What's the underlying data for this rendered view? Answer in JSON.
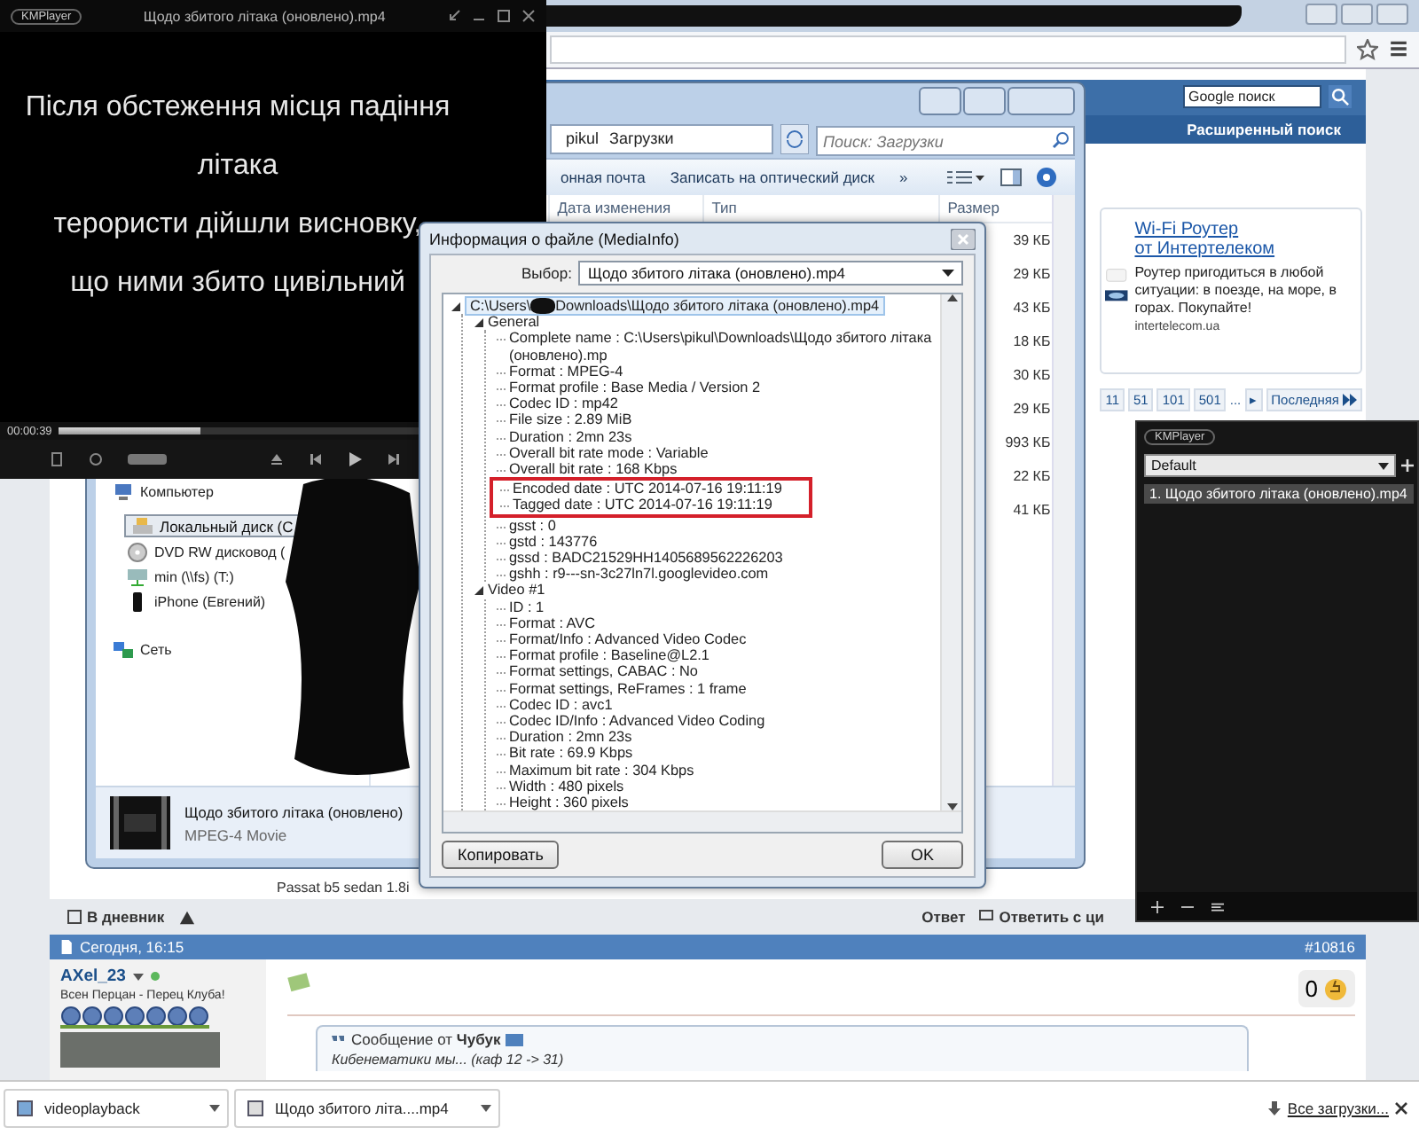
{
  "browser": {
    "search": {
      "value": "Google поиск"
    },
    "advanced_search": "Расширенный поиск",
    "ad": {
      "title": [
        "Wi-Fi Роутер",
        "от Интертелеком"
      ],
      "text": "Роутер пригодиться в любой ситуации: в поезде, на море, в горах. Покупайте!",
      "domain": "intertelecom.ua"
    },
    "pagination": {
      "pages": [
        "11",
        "51",
        "101",
        "501"
      ],
      "ellipsis": "...",
      "next": "▸",
      "last": "Последняя"
    },
    "snippet": "Passat b5 sedan 1.8i",
    "post_actions": {
      "diary": "В дневник",
      "reply": "Ответ",
      "quote_reply": "Ответить с ци"
    },
    "post": {
      "date": "Сегодня, 16:15",
      "number": "#10816",
      "author": "AXel_23",
      "online": true,
      "user_title": "Всен Перцан - Перец Клуба!",
      "rating": "0",
      "quote_header": "Сообщение от **Чубук**",
      "quote_text": "Кибенематики мы... (каф 12 -> 31)"
    }
  },
  "downloads": {
    "items": [
      "videoplayback",
      "Щодо збитого літа....mp4"
    ],
    "show_all": "Все загрузки..."
  },
  "explorer": {
    "breadcrumb": [
      "pikul",
      "Загрузки"
    ],
    "search_placeholder": "Поиск: Загрузки",
    "toolbar": [
      "онная почта",
      "Записать на оптический диск",
      "»"
    ],
    "columns": [
      "Дата изменения",
      "Тип",
      "Размер"
    ],
    "sizes": [
      "39 КБ",
      "29 КБ",
      "43 КБ",
      "18 КБ",
      "30 КБ",
      "29 КБ",
      "993 КБ",
      "22 КБ",
      "41 КБ"
    ],
    "nav": [
      {
        "label": "Компьютер",
        "kind": "computer",
        "selected": false,
        "children": [
          {
            "label": "Локальный диск (С",
            "kind": "disk",
            "selected": true
          },
          {
            "label": "DVD RW дисковод (",
            "kind": "dvd",
            "selected": false
          },
          {
            "label": "min (\\\\fs) (T:)",
            "kind": "netdrive",
            "selected": false
          },
          {
            "label": "iPhone (Евгений)",
            "kind": "phone",
            "selected": false
          }
        ]
      },
      {
        "label": "Сеть",
        "kind": "network",
        "selected": false
      }
    ],
    "details": {
      "name": "Щодо збитого літака (оновлено)",
      "type": "MPEG-4 Movie"
    }
  },
  "kmplayer": {
    "logo": "KMPlayer",
    "title": "Щодо збитого літака (оновлено).mp4",
    "subtitles": [
      "Після обстеження місця падіння",
      "літака",
      "терористи дійшли висновку,",
      "що ними збито цивільний"
    ],
    "time": "00:00:39",
    "level": 0.3
  },
  "mediainfo": {
    "title": "Информация о файле (MediaInfo)",
    "select_label": "Выбор:",
    "select_value": "Щодо збитого літака (оновлено).mp4",
    "tree": {
      "label": "C:\\Users\\",
      "label_end": "Downloads\\Щодо збитого літака (оновлено).mp4",
      "selected": true,
      "expanded": true,
      "children": [
        {
          "text": "General",
          "expanded": true,
          "highlighted": false,
          "children": [
            {
              "text": "Complete name : C:\\Users\\pikul\\Downloads\\Щодо збитого літака (оновлено).mp",
              "highlighted": false
            },
            {
              "text": "Format : MPEG-4",
              "highlighted": false
            },
            {
              "text": "Format profile : Base Media / Version 2",
              "highlighted": false
            },
            {
              "text": "Codec ID : mp42",
              "highlighted": false
            },
            {
              "text": "File size : 2.89 MiB",
              "highlighted": false
            },
            {
              "text": "Duration : 2mn 23s",
              "highlighted": false
            },
            {
              "text": "Overall bit rate mode : Variable",
              "highlighted": false
            },
            {
              "text": "Overall bit rate : 168 Kbps",
              "highlighted": false
            },
            {
              "text": "Encoded date : UTC 2014-07-16 19:11:19",
              "highlighted": true
            },
            {
              "text": "Tagged date : UTC 2014-07-16 19:11:19",
              "highlighted": true
            },
            {
              "text": "gsst : 0",
              "highlighted": false
            },
            {
              "text": "gstd : 143776",
              "highlighted": false
            },
            {
              "text": "gssd : BADC21529HH1405689562226203",
              "highlighted": false
            },
            {
              "text": "gshh : r9---sn-3c27ln7l.googlevideo.com",
              "highlighted": false
            }
          ]
        },
        {
          "text": "Video #1",
          "expanded": true,
          "highlighted": false,
          "children": [
            {
              "text": "ID : 1",
              "highlighted": false
            },
            {
              "text": "Format : AVC",
              "highlighted": false
            },
            {
              "text": "Format/Info : Advanced Video Codec",
              "highlighted": false
            },
            {
              "text": "Format profile : Baseline@L2.1",
              "highlighted": false
            },
            {
              "text": "Format settings, CABAC : No",
              "highlighted": false
            },
            {
              "text": "Format settings, ReFrames : 1 frame",
              "highlighted": false
            },
            {
              "text": "Codec ID : avc1",
              "highlighted": false
            },
            {
              "text": "Codec ID/Info : Advanced Video Coding",
              "highlighted": false
            },
            {
              "text": "Duration : 2mn 23s",
              "highlighted": false
            },
            {
              "text": "Bit rate : 69.9 Kbps",
              "highlighted": false
            },
            {
              "text": "Maximum bit rate : 304 Kbps",
              "highlighted": false
            },
            {
              "text": "Width : 480 pixels",
              "highlighted": false
            },
            {
              "text": "Height : 360 pixels",
              "highlighted": false
            }
          ]
        }
      ]
    },
    "buttons": [
      "Копировать",
      "OK"
    ]
  },
  "playlist": {
    "logo": "KMPlayer",
    "list_name": "Default",
    "items": [
      {
        "label": "1. Щодо збитого літака (оновлено).mp4",
        "selected": true
      }
    ]
  }
}
